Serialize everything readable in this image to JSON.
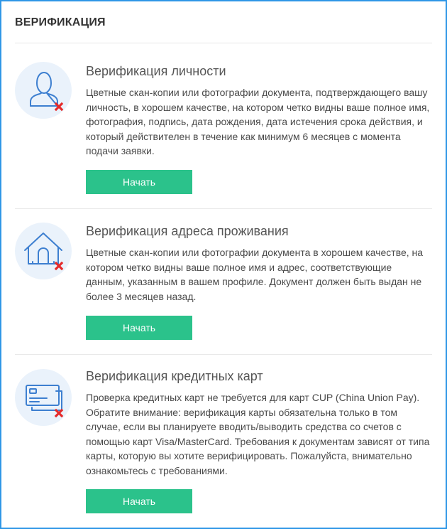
{
  "header": {
    "title": "ВЕРИФИКАЦИЯ"
  },
  "sections": [
    {
      "title": "Верификация личности",
      "description": "Цветные скан-копии или фотографии документа, подтверждающего вашу личность, в хорошем качестве, на котором четко видны ваше полное имя, фотография, подпись, дата рождения, дата истечения срока действия, и который действителен в течение как минимум 6 месяцев с момента подачи заявки.",
      "button_label": "Начать",
      "icon": "user-icon",
      "status": "not-verified"
    },
    {
      "title": "Верификация адреса проживания",
      "description": "Цветные скан-копии или фотографии документа в хорошем качестве, на котором четко видны ваше полное имя и адрес, соответствующие данным, указанным в вашем профиле. Документ должен быть выдан не более 3 месяцев назад.",
      "button_label": "Начать",
      "icon": "house-icon",
      "status": "not-verified"
    },
    {
      "title": "Верификация кредитных карт",
      "description": "Проверка кредитных карт не требуется для карт CUP (China Union Pay). Обратите внимание: верификация карты обязательна только в том случае, если вы планируете вводить/выводить средства со счетов с помощью карт Visa/MasterCard. Требования к документам зависят от типа карты, которую вы хотите верифицировать. Пожалуйста, внимательно ознакомьтесь с требованиями.",
      "button_label": "Начать",
      "icon": "credit-card-icon",
      "status": "not-verified"
    }
  ],
  "colors": {
    "frame_border": "#2f97e6",
    "button": "#2bc28b",
    "icon_stroke": "#3d7fd0",
    "icon_bg": "#eaf2fb",
    "status_x": "#e52a2a"
  }
}
